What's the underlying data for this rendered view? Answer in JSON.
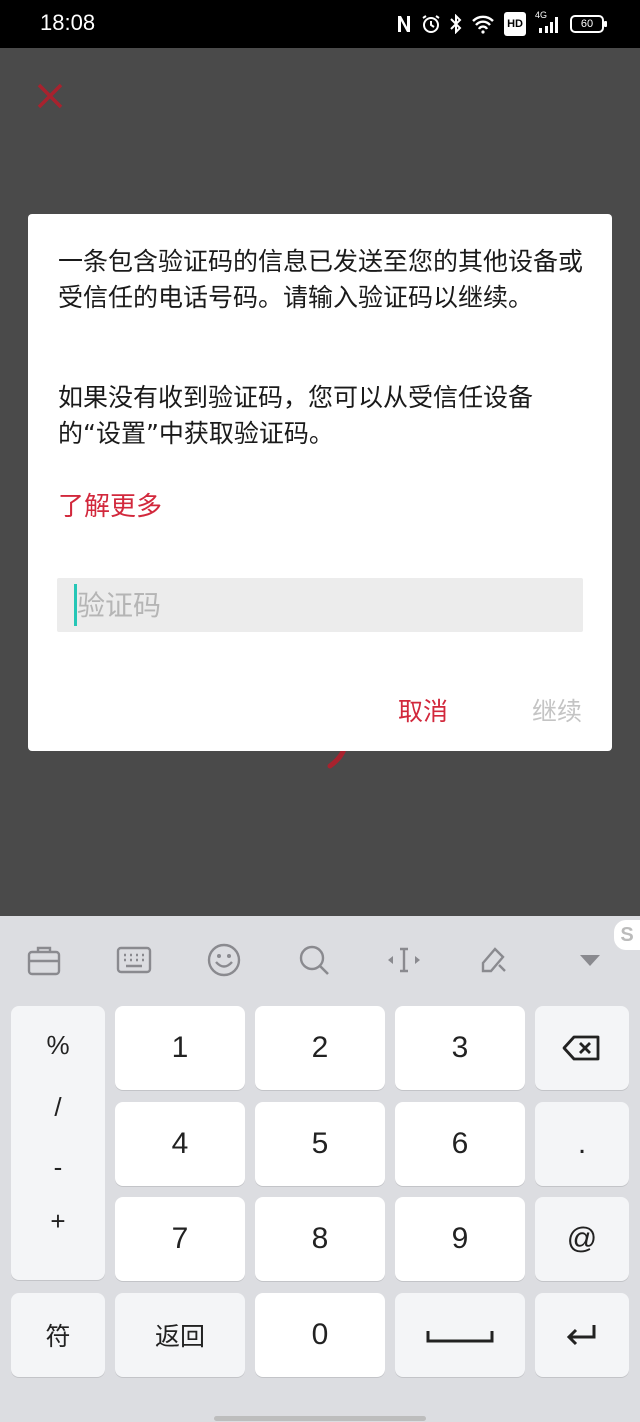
{
  "status_bar": {
    "time": "18:08",
    "hd_label": "HD",
    "network_label": "4G",
    "battery": "60",
    "icons": [
      "nfc-icon",
      "alarm-icon",
      "bluetooth-icon",
      "wifi-icon",
      "hd-icon",
      "signal-icon",
      "battery-icon"
    ]
  },
  "background": {
    "close_icon": "close-icon",
    "accent": "#b3202e"
  },
  "dialog": {
    "message": "一条包含验证码的信息已发送至您的其他设备或受信任的电话号码。请输入验证码以继续。",
    "message2": "如果没有收到验证码，您可以从受信任设备的“设置”中获取验证码。",
    "learn_more": "了解更多",
    "code_placeholder": "验证码",
    "code_value": "",
    "cancel_label": "取消",
    "continue_label": "继续",
    "accent_color": "#d2283c",
    "cursor_color": "#26c6b6"
  },
  "keyboard": {
    "toolbar": [
      "clipboard-icon",
      "keyboard-icon",
      "emoji-icon",
      "search-icon",
      "cursor-move-icon",
      "edit-icon",
      "collapse-icon"
    ],
    "brand_badge": "S",
    "symbols": [
      "%",
      "/",
      "-",
      "+"
    ],
    "digits": [
      "1",
      "2",
      "3",
      "4",
      "5",
      "6",
      "7",
      "8",
      "9",
      "0"
    ],
    "dot": ".",
    "at": "@",
    "symbol_switch": "符",
    "back": "返回"
  }
}
